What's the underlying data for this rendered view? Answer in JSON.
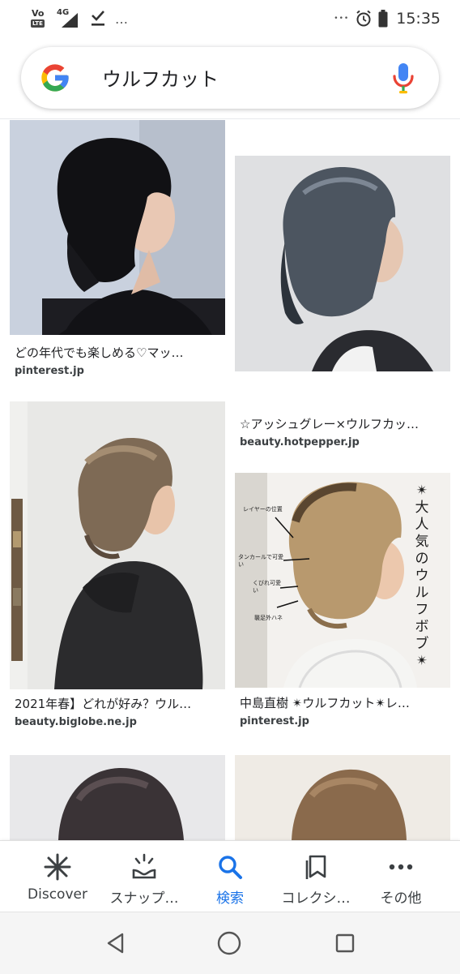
{
  "status_bar": {
    "volte": "Vo",
    "lte": "LTE",
    "network": "4G",
    "overflow": "…",
    "right_overflow": "•••",
    "time": "15:35",
    "icons": [
      "volte-icon",
      "signal-icon",
      "download-done-icon",
      "more-dots-icon",
      "alarm-icon",
      "battery-icon"
    ]
  },
  "search": {
    "query": "ウルフカット",
    "icons": [
      "google-logo",
      "mic-icon"
    ]
  },
  "results": [
    {
      "caption": "どの年代でも楽しめる♡マッ…",
      "source": "pinterest.jp"
    },
    {
      "caption": "☆アッシュグレー×ウルフカッ…",
      "source": "beauty.hotpepper.jp"
    },
    {
      "caption": "2021年春】どれが好み？ウル…",
      "source": "beauty.biglobe.ne.jp"
    },
    {
      "caption": "中島直樹 ✴ウルフカット✴レ…",
      "source": "pinterest.jp",
      "overlay": {
        "title": "✴大人気のウルフボブ✴",
        "notes": [
          "レイヤーの位置",
          "タンカールで可愛い",
          "くびれ可愛い",
          "襲足外ハネ"
        ]
      }
    }
  ],
  "bottom_nav": {
    "items": [
      {
        "label": "Discover",
        "icon": "discover-asterisk-icon"
      },
      {
        "label": "スナップ…",
        "icon": "snapshot-icon"
      },
      {
        "label": "検索",
        "icon": "search-icon"
      },
      {
        "label": "コレクシ…",
        "icon": "collections-icon"
      },
      {
        "label": "その他",
        "icon": "more-horiz-icon"
      }
    ],
    "active_index": 2
  },
  "system_nav": {
    "icons": [
      "back-icon",
      "home-icon",
      "recents-icon"
    ]
  },
  "colors": {
    "accent": "#1a73e8",
    "text": "#202124",
    "source_text": "#3c4043",
    "google_blue": "#4285f4",
    "google_red": "#ea4335",
    "google_yellow": "#fbbc05",
    "google_green": "#34a853"
  }
}
